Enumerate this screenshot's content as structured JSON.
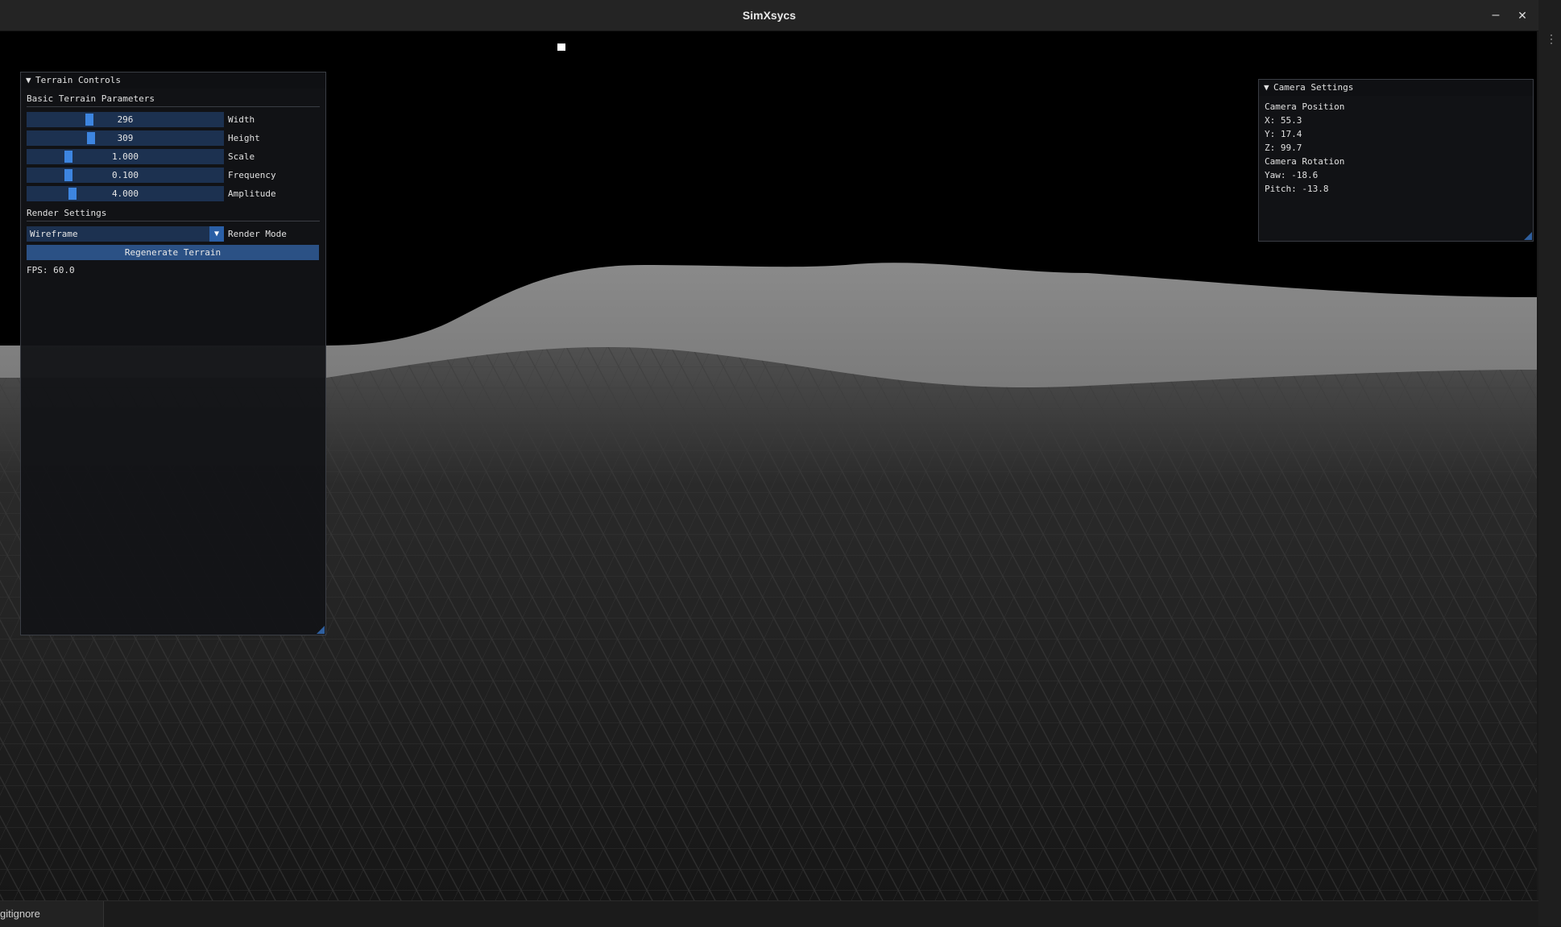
{
  "window": {
    "title": "SimXsycs",
    "minimize_glyph": "–",
    "close_glyph": "✕",
    "overflow_glyph": "⋮"
  },
  "terrain_panel": {
    "title": "Terrain Controls",
    "collapse_glyph": "▼",
    "basic_section": "Basic Terrain Parameters",
    "sliders": [
      {
        "label": "Width",
        "value": "296",
        "fraction": 0.31
      },
      {
        "label": "Height",
        "value": "309",
        "fraction": 0.32
      },
      {
        "label": "Scale",
        "value": "1.000",
        "fraction": 0.2
      },
      {
        "label": "Frequency",
        "value": "0.100",
        "fraction": 0.2
      },
      {
        "label": "Amplitude",
        "value": "4.000",
        "fraction": 0.22
      }
    ],
    "render_section": "Render Settings",
    "render_mode": {
      "value": "Wireframe",
      "label": "Render Mode",
      "arrow": "▼"
    },
    "regenerate_button": "Regenerate Terrain",
    "fps": "FPS: 60.0"
  },
  "camera_panel": {
    "title": "Camera Settings",
    "collapse_glyph": "▼",
    "position_label": "Camera Position",
    "x": "X: 55.3",
    "y": "Y: 17.4",
    "z": "Z: 99.7",
    "rotation_label": "Camera Rotation",
    "yaw": "Yaw: -18.6",
    "pitch": "Pitch: -13.8"
  },
  "statusbar": {
    "tab_label": "gitignore"
  },
  "colors": {
    "slider_bg": "#1c3150",
    "slider_grab": "#3d85e0",
    "button": "#2b5185",
    "viewport_bg": "#000000"
  }
}
